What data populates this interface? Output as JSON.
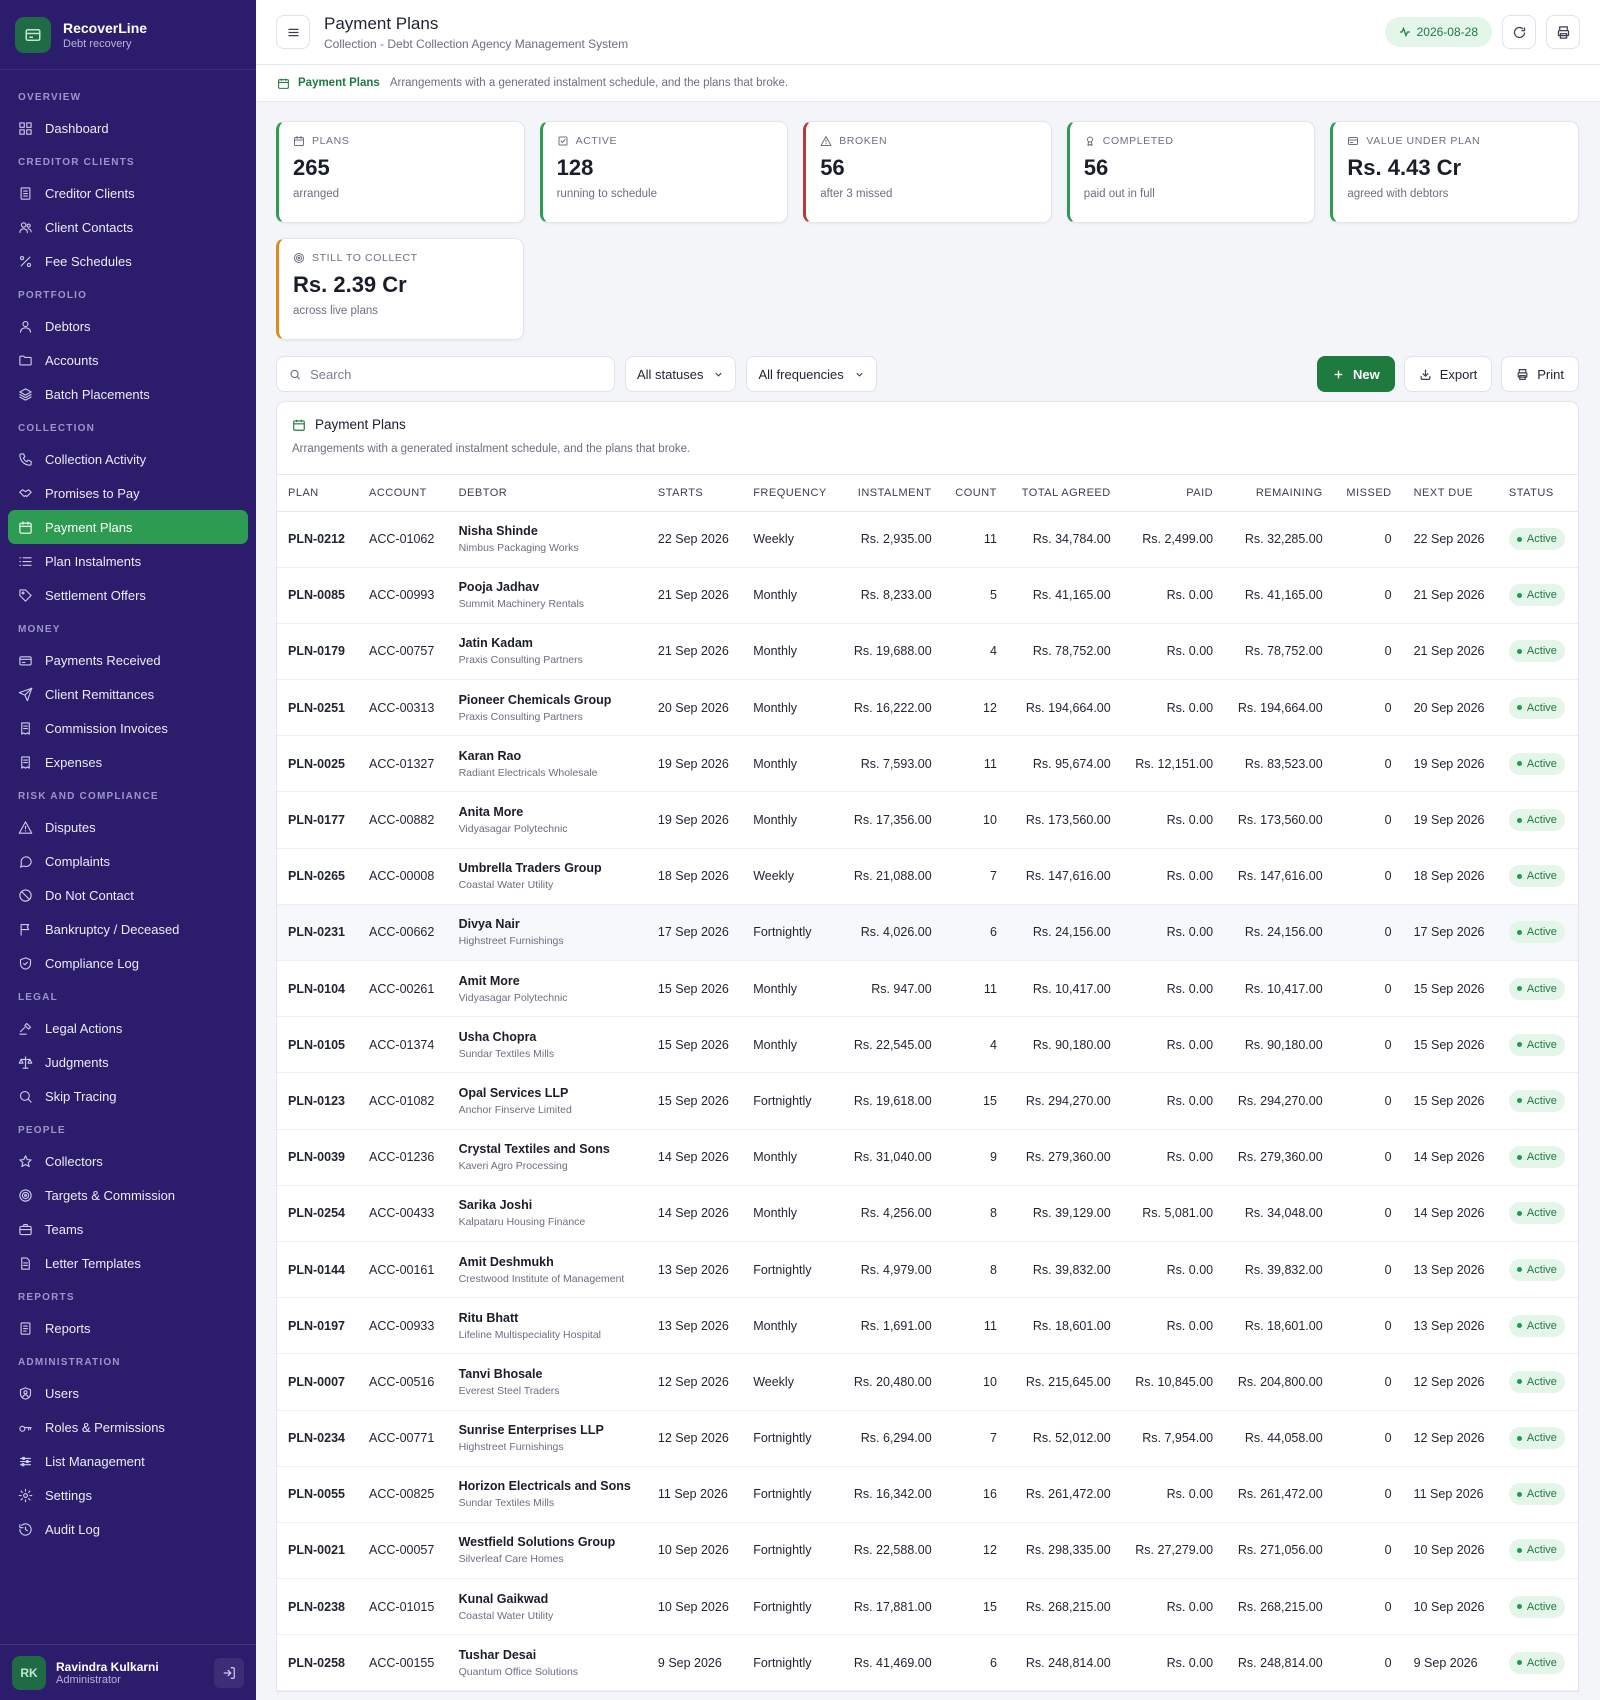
{
  "brand": {
    "name": "RecoverLine",
    "subtitle": "Debt recovery"
  },
  "nav": [
    {
      "section": "Overview",
      "items": [
        {
          "label": "Dashboard",
          "icon": "grid-icon"
        }
      ]
    },
    {
      "section": "Creditor Clients",
      "items": [
        {
          "label": "Creditor Clients",
          "icon": "building-icon"
        },
        {
          "label": "Client Contacts",
          "icon": "contacts-icon"
        },
        {
          "label": "Fee Schedules",
          "icon": "percent-icon"
        }
      ]
    },
    {
      "section": "Portfolio",
      "items": [
        {
          "label": "Debtors",
          "icon": "user-icon"
        },
        {
          "label": "Accounts",
          "icon": "folder-icon"
        },
        {
          "label": "Batch Placements",
          "icon": "layers-icon"
        }
      ]
    },
    {
      "section": "Collection",
      "items": [
        {
          "label": "Collection Activity",
          "icon": "phone-icon"
        },
        {
          "label": "Promises to Pay",
          "icon": "handshake-icon"
        },
        {
          "label": "Payment Plans",
          "icon": "calendar-icon",
          "active": true
        },
        {
          "label": "Plan Instalments",
          "icon": "list-icon"
        },
        {
          "label": "Settlement Offers",
          "icon": "tag-icon"
        }
      ]
    },
    {
      "section": "Money",
      "items": [
        {
          "label": "Payments Received",
          "icon": "wallet-icon"
        },
        {
          "label": "Client Remittances",
          "icon": "send-icon"
        },
        {
          "label": "Commission Invoices",
          "icon": "receipt-icon"
        },
        {
          "label": "Expenses",
          "icon": "receipt-icon"
        }
      ]
    },
    {
      "section": "Risk and Compliance",
      "items": [
        {
          "label": "Disputes",
          "icon": "alert-icon"
        },
        {
          "label": "Complaints",
          "icon": "chat-icon"
        },
        {
          "label": "Do Not Contact",
          "icon": "ban-icon"
        },
        {
          "label": "Bankruptcy / Deceased",
          "icon": "flag-icon"
        },
        {
          "label": "Compliance Log",
          "icon": "shield-icon"
        }
      ]
    },
    {
      "section": "Legal",
      "items": [
        {
          "label": "Legal Actions",
          "icon": "gavel-icon"
        },
        {
          "label": "Judgments",
          "icon": "scale-icon"
        },
        {
          "label": "Skip Tracing",
          "icon": "search-icon"
        }
      ]
    },
    {
      "section": "People",
      "items": [
        {
          "label": "Collectors",
          "icon": "star-icon"
        },
        {
          "label": "Targets & Commission",
          "icon": "target-icon"
        },
        {
          "label": "Teams",
          "icon": "briefcase-icon"
        },
        {
          "label": "Letter Templates",
          "icon": "document-icon"
        }
      ]
    },
    {
      "section": "Reports",
      "items": [
        {
          "label": "Reports",
          "icon": "report-icon"
        }
      ]
    },
    {
      "section": "Administration",
      "items": [
        {
          "label": "Users",
          "icon": "user-shield-icon"
        },
        {
          "label": "Roles & Permissions",
          "icon": "key-icon"
        },
        {
          "label": "List Management",
          "icon": "sliders-icon"
        },
        {
          "label": "Settings",
          "icon": "gear-icon"
        },
        {
          "label": "Audit Log",
          "icon": "history-icon"
        }
      ]
    }
  ],
  "user": {
    "initials": "RK",
    "name": "Ravindra Kulkarni",
    "role": "Administrator"
  },
  "header": {
    "title": "Payment Plans",
    "subtitle": "Collection - Debt Collection Agency Management System",
    "date": "2026-08-28"
  },
  "subbar": {
    "title": "Payment Plans",
    "description": "Arrangements with a generated instalment schedule, and the plans that broke."
  },
  "stats": [
    {
      "label": "Plans",
      "value": "265",
      "caption": "arranged",
      "icon": "calendar-icon",
      "accent": "#2e9b52"
    },
    {
      "label": "Active",
      "value": "128",
      "caption": "running to schedule",
      "icon": "check-square-icon",
      "accent": "#2e9b52"
    },
    {
      "label": "Broken",
      "value": "56",
      "caption": "after 3 missed",
      "icon": "alert-icon",
      "accent": "#b73a3a"
    },
    {
      "label": "Completed",
      "value": "56",
      "caption": "paid out in full",
      "icon": "award-icon",
      "accent": "#2e9b52"
    },
    {
      "label": "Value Under Plan",
      "value": "Rs. 4.43 Cr",
      "caption": "agreed with debtors",
      "icon": "card-icon",
      "accent": "#2e9b52"
    },
    {
      "label": "Still to Collect",
      "value": "Rs. 2.39 Cr",
      "caption": "across live plans",
      "icon": "target-icon",
      "accent": "#d98b1c"
    }
  ],
  "toolbar": {
    "search_placeholder": "Search",
    "status_filter": "All statuses",
    "frequency_filter": "All frequencies",
    "new_label": "New",
    "export_label": "Export",
    "print_label": "Print"
  },
  "table": {
    "title": "Payment Plans",
    "description": "Arrangements with a generated instalment schedule, and the plans that broke.",
    "columns": [
      "Plan",
      "Account",
      "Debtor",
      "Starts",
      "Frequency",
      "Instalment",
      "Count",
      "Total Agreed",
      "Paid",
      "Remaining",
      "Missed",
      "Next Due",
      "Status"
    ],
    "rows": [
      {
        "plan": "PLN-0212",
        "account": "ACC-01062",
        "debtor": "Nisha Shinde",
        "client": "Nimbus Packaging Works",
        "starts": "22 Sep 2026",
        "frequency": "Weekly",
        "instalment": "Rs. 2,935.00",
        "count": "11",
        "total": "Rs. 34,784.00",
        "paid": "Rs. 2,499.00",
        "remaining": "Rs. 32,285.00",
        "missed": "0",
        "next_due": "22 Sep 2026",
        "status": "Active"
      },
      {
        "plan": "PLN-0085",
        "account": "ACC-00993",
        "debtor": "Pooja Jadhav",
        "client": "Summit Machinery Rentals",
        "starts": "21 Sep 2026",
        "frequency": "Monthly",
        "instalment": "Rs. 8,233.00",
        "count": "5",
        "total": "Rs. 41,165.00",
        "paid": "Rs. 0.00",
        "remaining": "Rs. 41,165.00",
        "missed": "0",
        "next_due": "21 Sep 2026",
        "status": "Active"
      },
      {
        "plan": "PLN-0179",
        "account": "ACC-00757",
        "debtor": "Jatin Kadam",
        "client": "Praxis Consulting Partners",
        "starts": "21 Sep 2026",
        "frequency": "Monthly",
        "instalment": "Rs. 19,688.00",
        "count": "4",
        "total": "Rs. 78,752.00",
        "paid": "Rs. 0.00",
        "remaining": "Rs. 78,752.00",
        "missed": "0",
        "next_due": "21 Sep 2026",
        "status": "Active"
      },
      {
        "plan": "PLN-0251",
        "account": "ACC-00313",
        "debtor": "Pioneer Chemicals Group",
        "client": "Praxis Consulting Partners",
        "starts": "20 Sep 2026",
        "frequency": "Monthly",
        "instalment": "Rs. 16,222.00",
        "count": "12",
        "total": "Rs. 194,664.00",
        "paid": "Rs. 0.00",
        "remaining": "Rs. 194,664.00",
        "missed": "0",
        "next_due": "20 Sep 2026",
        "status": "Active"
      },
      {
        "plan": "PLN-0025",
        "account": "ACC-01327",
        "debtor": "Karan Rao",
        "client": "Radiant Electricals Wholesale",
        "starts": "19 Sep 2026",
        "frequency": "Monthly",
        "instalment": "Rs. 7,593.00",
        "count": "11",
        "total": "Rs. 95,674.00",
        "paid": "Rs. 12,151.00",
        "remaining": "Rs. 83,523.00",
        "missed": "0",
        "next_due": "19 Sep 2026",
        "status": "Active"
      },
      {
        "plan": "PLN-0177",
        "account": "ACC-00882",
        "debtor": "Anita More",
        "client": "Vidyasagar Polytechnic",
        "starts": "19 Sep 2026",
        "frequency": "Monthly",
        "instalment": "Rs. 17,356.00",
        "count": "10",
        "total": "Rs. 173,560.00",
        "paid": "Rs. 0.00",
        "remaining": "Rs. 173,560.00",
        "missed": "0",
        "next_due": "19 Sep 2026",
        "status": "Active"
      },
      {
        "plan": "PLN-0265",
        "account": "ACC-00008",
        "debtor": "Umbrella Traders Group",
        "client": "Coastal Water Utility",
        "starts": "18 Sep 2026",
        "frequency": "Weekly",
        "instalment": "Rs. 21,088.00",
        "count": "7",
        "total": "Rs. 147,616.00",
        "paid": "Rs. 0.00",
        "remaining": "Rs. 147,616.00",
        "missed": "0",
        "next_due": "18 Sep 2026",
        "status": "Active"
      },
      {
        "plan": "PLN-0231",
        "account": "ACC-00662",
        "debtor": "Divya Nair",
        "client": "Highstreet Furnishings",
        "starts": "17 Sep 2026",
        "frequency": "Fortnightly",
        "instalment": "Rs. 4,026.00",
        "count": "6",
        "total": "Rs. 24,156.00",
        "paid": "Rs. 0.00",
        "remaining": "Rs. 24,156.00",
        "missed": "0",
        "next_due": "17 Sep 2026",
        "status": "Active",
        "highlighted": true
      },
      {
        "plan": "PLN-0104",
        "account": "ACC-00261",
        "debtor": "Amit More",
        "client": "Vidyasagar Polytechnic",
        "starts": "15 Sep 2026",
        "frequency": "Monthly",
        "instalment": "Rs. 947.00",
        "count": "11",
        "total": "Rs. 10,417.00",
        "paid": "Rs. 0.00",
        "remaining": "Rs. 10,417.00",
        "missed": "0",
        "next_due": "15 Sep 2026",
        "status": "Active"
      },
      {
        "plan": "PLN-0105",
        "account": "ACC-01374",
        "debtor": "Usha Chopra",
        "client": "Sundar Textiles Mills",
        "starts": "15 Sep 2026",
        "frequency": "Monthly",
        "instalment": "Rs. 22,545.00",
        "count": "4",
        "total": "Rs. 90,180.00",
        "paid": "Rs. 0.00",
        "remaining": "Rs. 90,180.00",
        "missed": "0",
        "next_due": "15 Sep 2026",
        "status": "Active"
      },
      {
        "plan": "PLN-0123",
        "account": "ACC-01082",
        "debtor": "Opal Services LLP",
        "client": "Anchor Finserve Limited",
        "starts": "15 Sep 2026",
        "frequency": "Fortnightly",
        "instalment": "Rs. 19,618.00",
        "count": "15",
        "total": "Rs. 294,270.00",
        "paid": "Rs. 0.00",
        "remaining": "Rs. 294,270.00",
        "missed": "0",
        "next_due": "15 Sep 2026",
        "status": "Active"
      },
      {
        "plan": "PLN-0039",
        "account": "ACC-01236",
        "debtor": "Crystal Textiles and Sons",
        "client": "Kaveri Agro Processing",
        "starts": "14 Sep 2026",
        "frequency": "Monthly",
        "instalment": "Rs. 31,040.00",
        "count": "9",
        "total": "Rs. 279,360.00",
        "paid": "Rs. 0.00",
        "remaining": "Rs. 279,360.00",
        "missed": "0",
        "next_due": "14 Sep 2026",
        "status": "Active"
      },
      {
        "plan": "PLN-0254",
        "account": "ACC-00433",
        "debtor": "Sarika Joshi",
        "client": "Kalpataru Housing Finance",
        "starts": "14 Sep 2026",
        "frequency": "Monthly",
        "instalment": "Rs. 4,256.00",
        "count": "8",
        "total": "Rs. 39,129.00",
        "paid": "Rs. 5,081.00",
        "remaining": "Rs. 34,048.00",
        "missed": "0",
        "next_due": "14 Sep 2026",
        "status": "Active"
      },
      {
        "plan": "PLN-0144",
        "account": "ACC-00161",
        "debtor": "Amit Deshmukh",
        "client": "Crestwood Institute of Management",
        "starts": "13 Sep 2026",
        "frequency": "Fortnightly",
        "instalment": "Rs. 4,979.00",
        "count": "8",
        "total": "Rs. 39,832.00",
        "paid": "Rs. 0.00",
        "remaining": "Rs. 39,832.00",
        "missed": "0",
        "next_due": "13 Sep 2026",
        "status": "Active"
      },
      {
        "plan": "PLN-0197",
        "account": "ACC-00933",
        "debtor": "Ritu Bhatt",
        "client": "Lifeline Multispeciality Hospital",
        "starts": "13 Sep 2026",
        "frequency": "Monthly",
        "instalment": "Rs. 1,691.00",
        "count": "11",
        "total": "Rs. 18,601.00",
        "paid": "Rs. 0.00",
        "remaining": "Rs. 18,601.00",
        "missed": "0",
        "next_due": "13 Sep 2026",
        "status": "Active"
      },
      {
        "plan": "PLN-0007",
        "account": "ACC-00516",
        "debtor": "Tanvi Bhosale",
        "client": "Everest Steel Traders",
        "starts": "12 Sep 2026",
        "frequency": "Weekly",
        "instalment": "Rs. 20,480.00",
        "count": "10",
        "total": "Rs. 215,645.00",
        "paid": "Rs. 10,845.00",
        "remaining": "Rs. 204,800.00",
        "missed": "0",
        "next_due": "12 Sep 2026",
        "status": "Active"
      },
      {
        "plan": "PLN-0234",
        "account": "ACC-00771",
        "debtor": "Sunrise Enterprises LLP",
        "client": "Highstreet Furnishings",
        "starts": "12 Sep 2026",
        "frequency": "Fortnightly",
        "instalment": "Rs. 6,294.00",
        "count": "7",
        "total": "Rs. 52,012.00",
        "paid": "Rs. 7,954.00",
        "remaining": "Rs. 44,058.00",
        "missed": "0",
        "next_due": "12 Sep 2026",
        "status": "Active"
      },
      {
        "plan": "PLN-0055",
        "account": "ACC-00825",
        "debtor": "Horizon Electricals and Sons",
        "client": "Sundar Textiles Mills",
        "starts": "11 Sep 2026",
        "frequency": "Fortnightly",
        "instalment": "Rs. 16,342.00",
        "count": "16",
        "total": "Rs. 261,472.00",
        "paid": "Rs. 0.00",
        "remaining": "Rs. 261,472.00",
        "missed": "0",
        "next_due": "11 Sep 2026",
        "status": "Active"
      },
      {
        "plan": "PLN-0021",
        "account": "ACC-00057",
        "debtor": "Westfield Solutions Group",
        "client": "Silverleaf Care Homes",
        "starts": "10 Sep 2026",
        "frequency": "Fortnightly",
        "instalment": "Rs. 22,588.00",
        "count": "12",
        "total": "Rs. 298,335.00",
        "paid": "Rs. 27,279.00",
        "remaining": "Rs. 271,056.00",
        "missed": "0",
        "next_due": "10 Sep 2026",
        "status": "Active"
      },
      {
        "plan": "PLN-0238",
        "account": "ACC-01015",
        "debtor": "Kunal Gaikwad",
        "client": "Coastal Water Utility",
        "starts": "10 Sep 2026",
        "frequency": "Fortnightly",
        "instalment": "Rs. 17,881.00",
        "count": "15",
        "total": "Rs. 268,215.00",
        "paid": "Rs. 0.00",
        "remaining": "Rs. 268,215.00",
        "missed": "0",
        "next_due": "10 Sep 2026",
        "status": "Active"
      },
      {
        "plan": "PLN-0258",
        "account": "ACC-00155",
        "debtor": "Tushar Desai",
        "client": "Quantum Office Solutions",
        "starts": "9 Sep 2026",
        "frequency": "Fortnightly",
        "instalment": "Rs. 41,469.00",
        "count": "6",
        "total": "Rs. 248,814.00",
        "paid": "Rs. 0.00",
        "remaining": "Rs. 248,814.00",
        "missed": "0",
        "next_due": "9 Sep 2026",
        "status": "Active"
      }
    ]
  },
  "colors": {
    "sidebar": "#2b1d6b",
    "accent": "#2e9b52",
    "primary_button": "#1f7a3f",
    "broken": "#b73a3a",
    "collect": "#d98b1c"
  }
}
